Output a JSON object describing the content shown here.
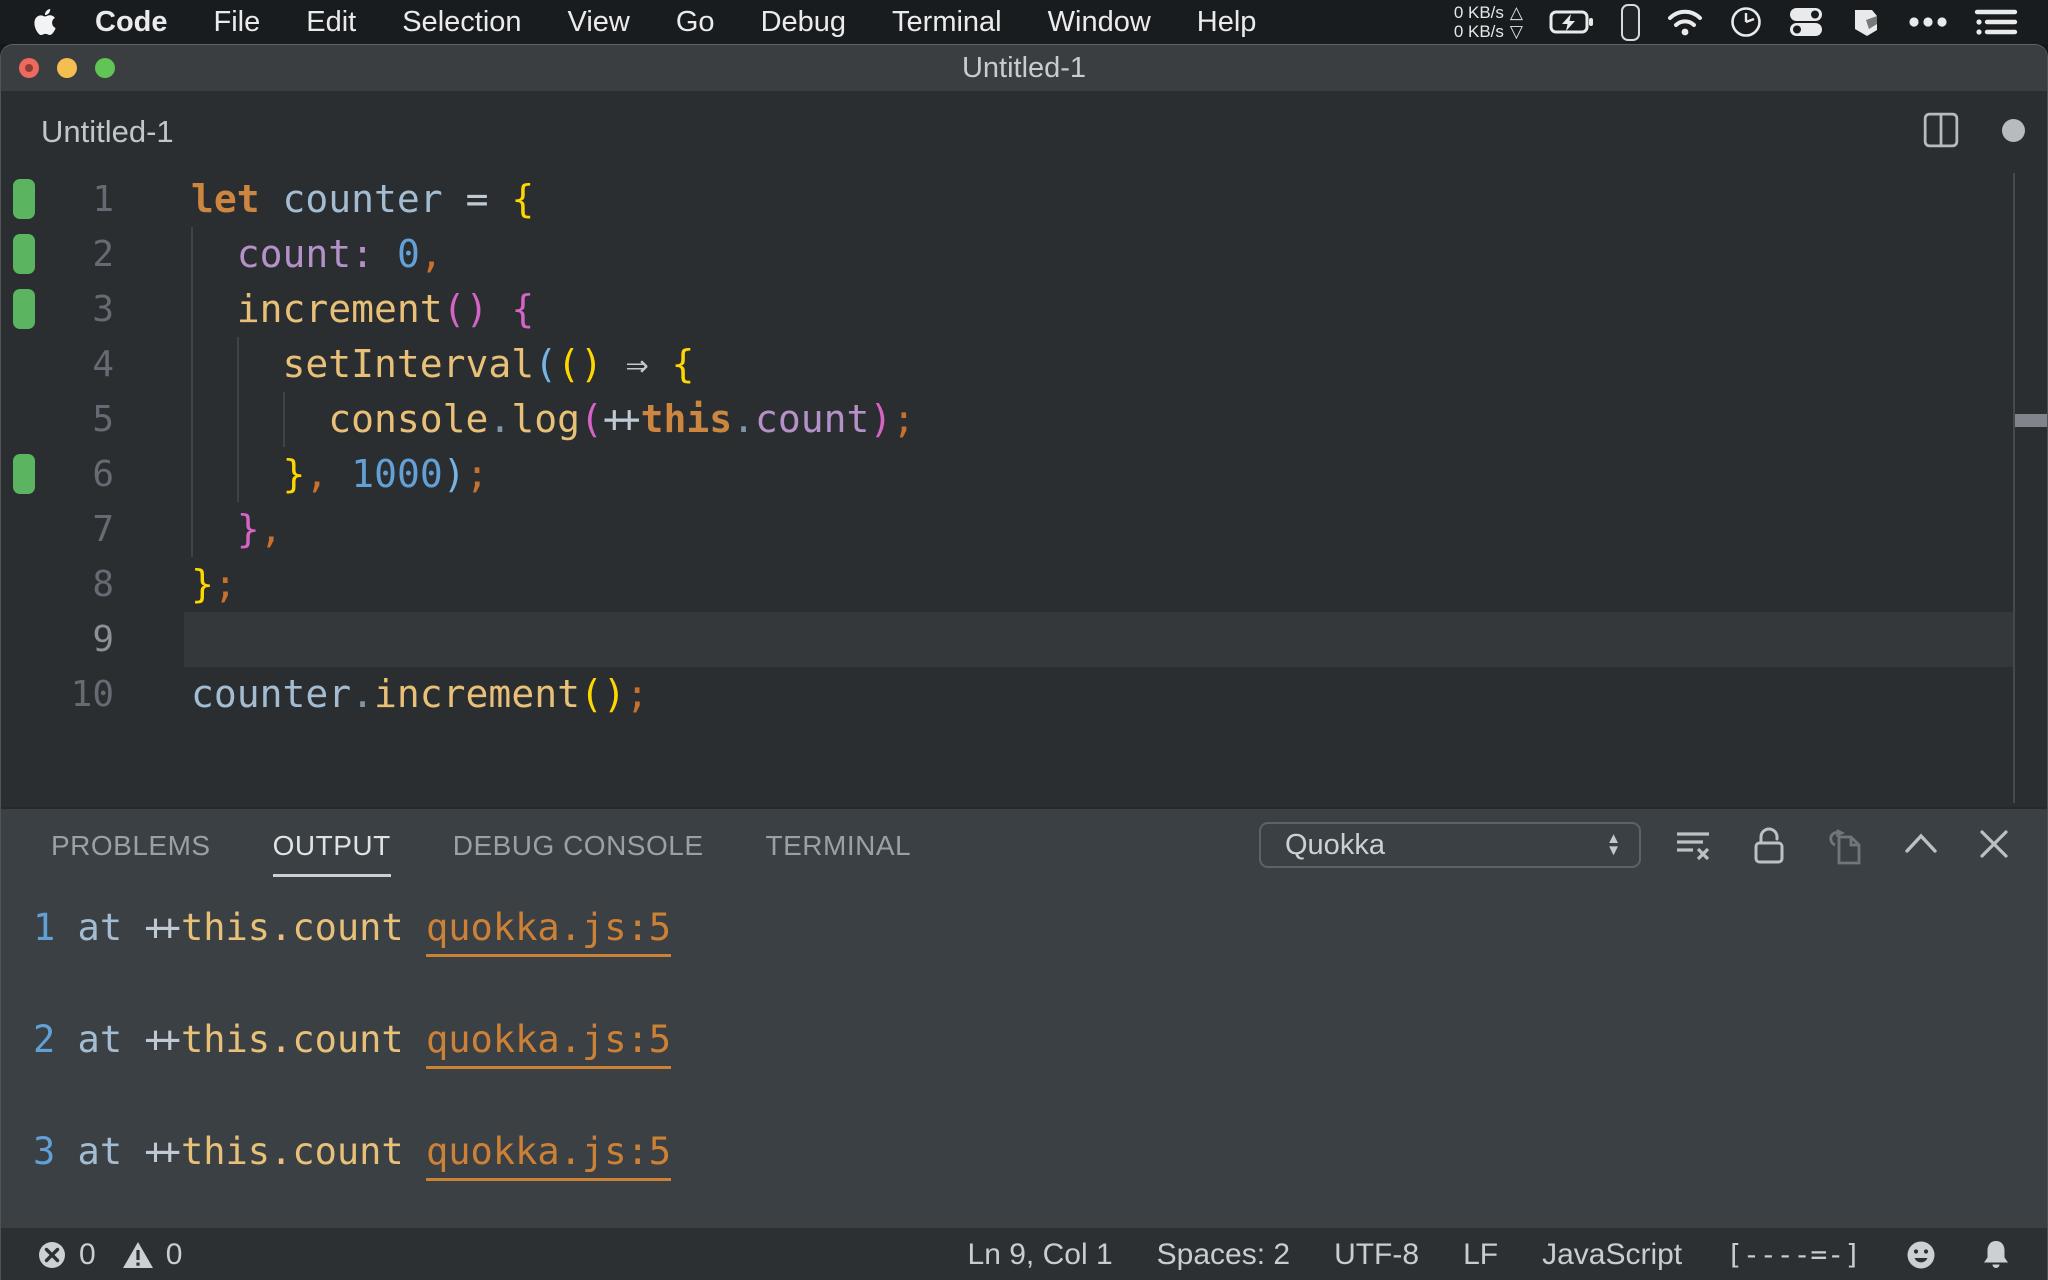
{
  "menubar": {
    "apple_icon": "apple-logo",
    "items": [
      "Code",
      "File",
      "Edit",
      "Selection",
      "View",
      "Go",
      "Debug",
      "Terminal",
      "Window",
      "Help"
    ],
    "bold_item": "Code",
    "net_up": "0 KB/s",
    "net_down": "0 KB/s",
    "up_arrow": "△",
    "down_arrow": "▽"
  },
  "window": {
    "title": "Untitled-1"
  },
  "editor_header": {
    "title": "Untitled-1"
  },
  "editor": {
    "lines": [
      {
        "num": "1",
        "quokka": true,
        "current": false,
        "tokens": [
          {
            "t": "let",
            "c": "kw"
          },
          {
            "t": " ",
            "c": "op"
          },
          {
            "t": "counter",
            "c": "var"
          },
          {
            "t": " = ",
            "c": "op"
          },
          {
            "t": "{",
            "c": "b1"
          }
        ]
      },
      {
        "num": "2",
        "quokka": true,
        "current": false,
        "tokens": [
          {
            "t": "  ",
            "c": "op"
          },
          {
            "t": "count:",
            "c": "prop"
          },
          {
            "t": " ",
            "c": "op"
          },
          {
            "t": "0",
            "c": "num"
          },
          {
            "t": ",",
            "c": "pn"
          }
        ]
      },
      {
        "num": "3",
        "quokka": true,
        "current": false,
        "tokens": [
          {
            "t": "  ",
            "c": "op"
          },
          {
            "t": "increment",
            "c": "fn"
          },
          {
            "t": "()",
            "c": "b2"
          },
          {
            "t": " ",
            "c": "op"
          },
          {
            "t": "{",
            "c": "b2"
          }
        ]
      },
      {
        "num": "4",
        "quokka": false,
        "current": false,
        "tokens": [
          {
            "t": "    ",
            "c": "op"
          },
          {
            "t": "setInterval",
            "c": "fn"
          },
          {
            "t": "(",
            "c": "b3"
          },
          {
            "t": "()",
            "c": "b1"
          },
          {
            "t": " ",
            "c": "op"
          },
          {
            "t": "⇒",
            "c": "op"
          },
          {
            "t": " ",
            "c": "op"
          },
          {
            "t": "{",
            "c": "b1"
          }
        ]
      },
      {
        "num": "5",
        "quokka": false,
        "current": false,
        "tokens": [
          {
            "t": "      ",
            "c": "op"
          },
          {
            "t": "console",
            "c": "fn"
          },
          {
            "t": ".",
            "c": "dot"
          },
          {
            "t": "log",
            "c": "fn"
          },
          {
            "t": "(",
            "c": "b2"
          },
          {
            "t": "++",
            "c": "plusplus"
          },
          {
            "t": "this",
            "c": "kw"
          },
          {
            "t": ".",
            "c": "dot"
          },
          {
            "t": "count",
            "c": "prop"
          },
          {
            "t": ")",
            "c": "b2"
          },
          {
            "t": ";",
            "c": "pn"
          }
        ]
      },
      {
        "num": "6",
        "quokka": true,
        "current": false,
        "tokens": [
          {
            "t": "    ",
            "c": "op"
          },
          {
            "t": "}",
            "c": "b1"
          },
          {
            "t": ",",
            "c": "pn"
          },
          {
            "t": " ",
            "c": "op"
          },
          {
            "t": "1000",
            "c": "num"
          },
          {
            "t": ")",
            "c": "b3"
          },
          {
            "t": ";",
            "c": "pn"
          }
        ]
      },
      {
        "num": "7",
        "quokka": false,
        "current": false,
        "tokens": [
          {
            "t": "  ",
            "c": "op"
          },
          {
            "t": "}",
            "c": "b2"
          },
          {
            "t": ",",
            "c": "pn"
          }
        ]
      },
      {
        "num": "8",
        "quokka": false,
        "current": false,
        "tokens": [
          {
            "t": "}",
            "c": "b1"
          },
          {
            "t": ";",
            "c": "pn"
          }
        ]
      },
      {
        "num": "9",
        "quokka": false,
        "current": true,
        "tokens": []
      },
      {
        "num": "10",
        "quokka": false,
        "current": false,
        "tokens": [
          {
            "t": "counter",
            "c": "var"
          },
          {
            "t": ".",
            "c": "dot"
          },
          {
            "t": "increment",
            "c": "fn"
          },
          {
            "t": "()",
            "c": "b1"
          },
          {
            "t": ";",
            "c": "pn"
          }
        ]
      }
    ]
  },
  "panel": {
    "tabs": [
      {
        "label": "PROBLEMS",
        "active": false
      },
      {
        "label": "OUTPUT",
        "active": true
      },
      {
        "label": "DEBUG CONSOLE",
        "active": false
      },
      {
        "label": "TERMINAL",
        "active": false
      }
    ],
    "channel_select": "Quokka",
    "logs": [
      {
        "tokens": [
          {
            "t": "1",
            "c": "num"
          },
          {
            "t": " at ",
            "c": "at"
          },
          {
            "t": "++",
            "c": "plusplus"
          },
          {
            "t": "this.count",
            "c": "fn"
          },
          {
            "t": " ",
            "c": "at"
          },
          {
            "t": "quokka.js:5",
            "c": "link"
          }
        ]
      },
      {
        "tokens": [
          {
            "t": "2",
            "c": "num"
          },
          {
            "t": " at ",
            "c": "at"
          },
          {
            "t": "++",
            "c": "plusplus"
          },
          {
            "t": "this.count",
            "c": "fn"
          },
          {
            "t": " ",
            "c": "at"
          },
          {
            "t": "quokka.js:5",
            "c": "link"
          }
        ]
      },
      {
        "tokens": [
          {
            "t": "3",
            "c": "num"
          },
          {
            "t": " at ",
            "c": "at"
          },
          {
            "t": "++",
            "c": "plusplus"
          },
          {
            "t": "this.count",
            "c": "fn"
          },
          {
            "t": " ",
            "c": "at"
          },
          {
            "t": "quokka.js:5",
            "c": "link"
          }
        ]
      }
    ]
  },
  "statusbar": {
    "errors": "0",
    "warnings": "0",
    "items": [
      "Ln 9, Col 1",
      "Spaces: 2",
      "UTF-8",
      "LF",
      "JavaScript",
      "[----=-]"
    ]
  },
  "colors": {
    "bg_menubar": "#191c1e",
    "bg_titlebar": "#3a3e41",
    "bg_editor": "#2b2e30",
    "bg_panel": "#3a4043",
    "bg_statusbar": "#2c3033",
    "bg_line_highlight": "#34383a",
    "quokka_green": "#5bb45f",
    "traffic_red": "#ec6a5e",
    "traffic_yellow": "#f4bf4f",
    "traffic_green": "#61c454",
    "tk_keyword": "#cd8640",
    "tk_variable": "#a3bcd2",
    "tk_function": "#e8c077",
    "tk_property": "#b491c8",
    "tk_number": "#62a0d6",
    "tk_operator": "#bfcad4",
    "tk_punct": "#c8702e",
    "tk_dot": "#7e96ab",
    "bracket_yellow": "#ffd700",
    "bracket_pink": "#d663c6",
    "bracket_blue": "#75b4e4",
    "line_number": "#656b72",
    "line_number_active": "#8b9197",
    "guide": "#3e4347",
    "ui_text": "#c9cdcf",
    "ui_dim": "#9aa0a5",
    "link_orange": "#cd8136",
    "icon_dim": "#70767a",
    "dropdown_border": "#5c6367"
  }
}
